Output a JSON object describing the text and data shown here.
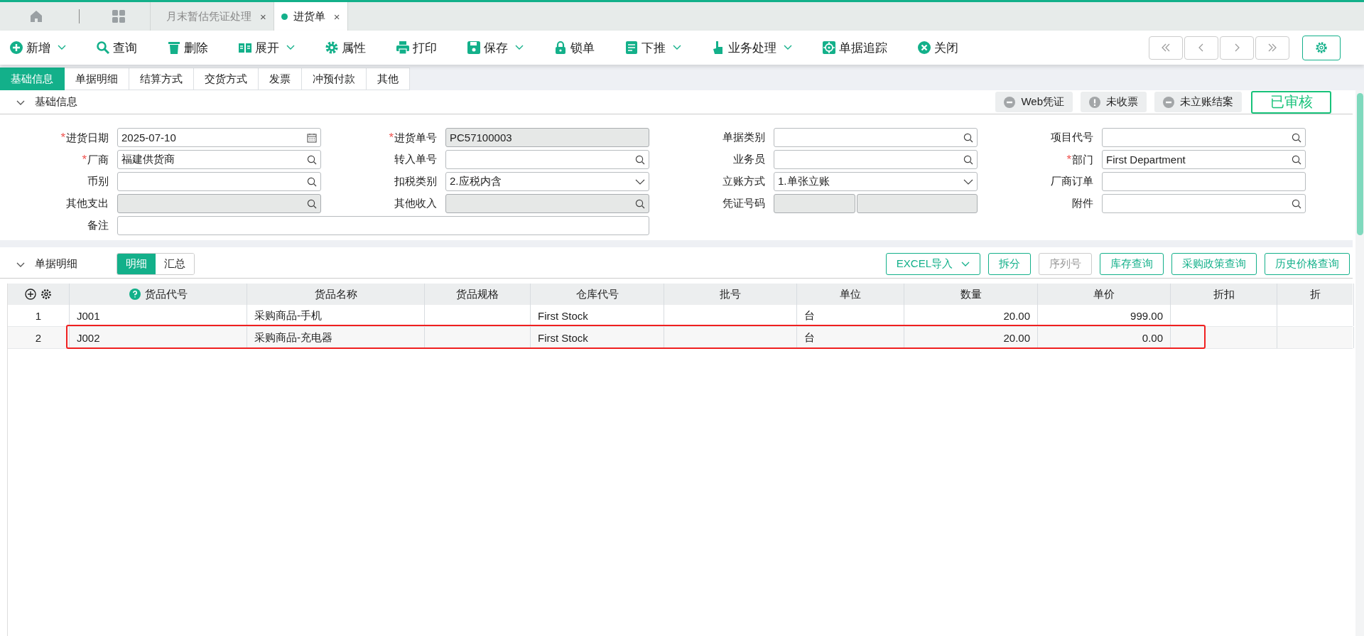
{
  "top_tabs": [
    {
      "label": "月末暂估凭证处理",
      "close": "×",
      "selected": false
    },
    {
      "label": "进货单",
      "close": "×",
      "selected": true
    }
  ],
  "toolbar": [
    {
      "label": "新增",
      "dropdown": true
    },
    {
      "label": "查询",
      "dropdown": false
    },
    {
      "label": "删除",
      "dropdown": false
    },
    {
      "label": "展开",
      "dropdown": true
    },
    {
      "label": "属性",
      "dropdown": false
    },
    {
      "label": "打印",
      "dropdown": false
    },
    {
      "label": "保存",
      "dropdown": true
    },
    {
      "label": "锁单",
      "dropdown": false
    },
    {
      "label": "下推",
      "dropdown": true
    },
    {
      "label": "业务处理",
      "dropdown": true
    },
    {
      "label": "单据追踪",
      "dropdown": false
    },
    {
      "label": "关闭",
      "dropdown": false
    }
  ],
  "form_tabs": [
    {
      "label": "基础信息",
      "selected": true
    },
    {
      "label": "单据明细",
      "selected": false
    },
    {
      "label": "结算方式",
      "selected": false
    },
    {
      "label": "交货方式",
      "selected": false
    },
    {
      "label": "发票",
      "selected": false
    },
    {
      "label": "冲预付款",
      "selected": false
    },
    {
      "label": "其他",
      "selected": false
    }
  ],
  "basic_section": {
    "title": "基础信息",
    "expanded": true,
    "statuses": [
      {
        "label": "Web凭证",
        "kind": "minus"
      },
      {
        "label": "未收票",
        "kind": "alert"
      },
      {
        "label": "未立账结案",
        "kind": "minus"
      }
    ],
    "stamp": "已审核",
    "fields": [
      {
        "label": "进货日期",
        "required_mark": "*",
        "kind": "date",
        "value": "2025-07-10",
        "readonly": false
      },
      {
        "label": "进货单号",
        "required_mark": "*",
        "kind": "plain",
        "value": "PC57100003",
        "readonly": true
      },
      {
        "label": "单据类别",
        "kind": "lookup",
        "readonly": false
      },
      {
        "label": "项目代号",
        "kind": "lookup",
        "readonly": false
      },
      {
        "label": "厂商",
        "required_mark": "*",
        "kind": "lookup",
        "value": "福建供货商",
        "readonly": false
      },
      {
        "label": "转入单号",
        "kind": "lookup",
        "readonly": false
      },
      {
        "label": "业务员",
        "kind": "lookup",
        "readonly": false
      },
      {
        "label": "部门",
        "required_mark": "*",
        "kind": "lookup",
        "value": "First Department",
        "readonly": false
      },
      {
        "label": "币别",
        "kind": "lookup",
        "readonly": false
      },
      {
        "label": "扣税类别",
        "kind": "select",
        "value": "2.应税内含",
        "readonly": false
      },
      {
        "label": "立账方式",
        "kind": "select",
        "value": "1.单张立账",
        "readonly": false
      },
      {
        "label": "厂商订单",
        "kind": "plain",
        "readonly": false
      },
      {
        "label": "其他支出",
        "kind": "lookup",
        "readonly": true
      },
      {
        "label": "其他收入",
        "kind": "lookup",
        "readonly": true
      },
      {
        "label": "凭证号码",
        "kind": "pair",
        "readonly": true
      },
      {
        "label": "附件",
        "kind": "lookup",
        "readonly": false
      },
      {
        "label": "备注",
        "kind": "wide",
        "readonly": false
      }
    ]
  },
  "detail_section": {
    "title": "单据明细",
    "expanded": true,
    "views": [
      {
        "label": "明细",
        "selected": true
      },
      {
        "label": "汇总",
        "selected": false
      }
    ],
    "buttons": [
      {
        "label": "EXCEL导入",
        "dropdown": true,
        "disabled": false
      },
      {
        "label": "拆分",
        "dropdown": false,
        "disabled": false
      },
      {
        "label": "序列号",
        "dropdown": false,
        "disabled": true
      },
      {
        "label": "库存查询",
        "dropdown": false,
        "disabled": false
      },
      {
        "label": "采购政策查询",
        "dropdown": false,
        "disabled": false
      },
      {
        "label": "历史价格查询",
        "dropdown": false,
        "disabled": false
      }
    ]
  },
  "table": {
    "columns": [
      {
        "label": "货品代号",
        "help": true
      },
      {
        "label": "货品名称",
        "help": false
      },
      {
        "label": "货品规格",
        "help": false
      },
      {
        "label": "仓库代号",
        "help": false
      },
      {
        "label": "批号",
        "help": false
      },
      {
        "label": "单位",
        "help": false
      },
      {
        "label": "数量",
        "help": false
      },
      {
        "label": "单价",
        "help": false
      },
      {
        "label": "折扣",
        "help": false
      },
      {
        "label": "折",
        "help": false
      }
    ],
    "rows": [
      {
        "index": "1",
        "highlighted": false,
        "cells": {
          "0": "J001",
          "1": "采购商品-手机",
          "3": "First Stock",
          "5": "台",
          "6": "20.00",
          "7": "999.00"
        }
      },
      {
        "index": "2",
        "highlighted": true,
        "cells": {
          "0": "J002",
          "1": "采购商品-充电器",
          "3": "First Stock",
          "5": "台",
          "6": "20.00",
          "7": "0.00"
        }
      }
    ]
  }
}
